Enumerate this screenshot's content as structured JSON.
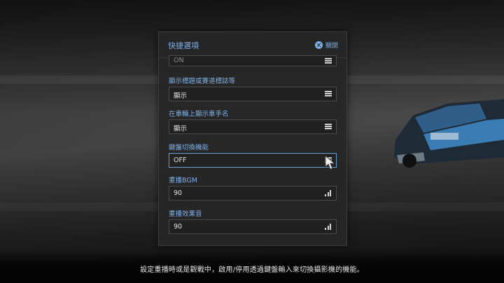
{
  "panel": {
    "title": "快捷選項",
    "close_label": "關閉"
  },
  "rows": [
    {
      "label": "",
      "value": "ON",
      "control": "list-icon"
    },
    {
      "label": "顯示標題或賽道標誌等",
      "value": "顯示",
      "control": "list-icon"
    },
    {
      "label": "在車輛上顯示車手名",
      "value": "顯示",
      "control": "list-icon"
    },
    {
      "label": "鍵盤切換機能",
      "value": "OFF",
      "control": "list-icon"
    },
    {
      "label": "重播BGM",
      "value": "90",
      "control": "bars-icon"
    },
    {
      "label": "重播效果音",
      "value": "90",
      "control": "bars-icon"
    }
  ],
  "hint_text": "設定重播時或是觀戰中，啟用/停用透過鍵盤輸入來切換攝影機的機能。",
  "colors": {
    "accent": "#7fb0e6",
    "panel_bg": "#262626",
    "active_border": "#6a9fd8"
  },
  "icons": [
    "close-icon",
    "scroll-up-icon",
    "list-icon",
    "bars-icon",
    "mouse-cursor-icon"
  ]
}
